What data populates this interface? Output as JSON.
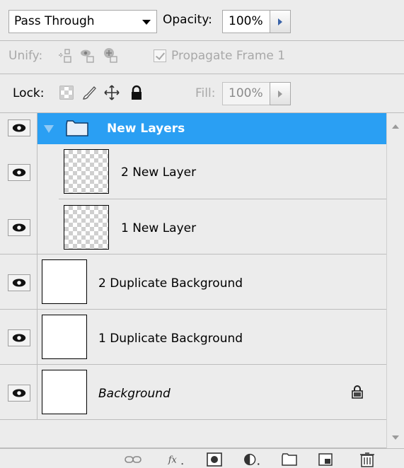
{
  "header": {
    "blend_mode": "Pass Through",
    "opacity_label": "Opacity:",
    "opacity_value": "100%",
    "unify_label": "Unify:",
    "propagate_label": "Propagate Frame 1",
    "propagate_checked": true,
    "lock_label": "Lock:",
    "fill_label": "Fill:",
    "fill_value": "100%"
  },
  "layers": [
    {
      "name": "New Layers",
      "kind": "group",
      "visible": true,
      "selected": true,
      "expanded": true
    },
    {
      "name": "2 New Layer",
      "kind": "layer",
      "visible": true,
      "transparent": true,
      "in_group": true
    },
    {
      "name": "1 New Layer",
      "kind": "layer",
      "visible": true,
      "transparent": true,
      "in_group": true
    },
    {
      "name": "2 Duplicate Background",
      "kind": "layer",
      "visible": true
    },
    {
      "name": "1 Duplicate Background",
      "kind": "layer",
      "visible": true
    },
    {
      "name": "Background",
      "kind": "background",
      "visible": true,
      "locked": true,
      "italic": true
    }
  ],
  "icons": {
    "visibility": "eye-icon",
    "group": "folder-icon",
    "lock": "lock-icon",
    "toolbar": [
      "link-layers-icon",
      "fx-icon",
      "layer-mask-icon",
      "adjustment-layer-icon",
      "new-group-icon",
      "new-layer-icon",
      "trash-icon"
    ]
  },
  "colors": {
    "selection": "#2a9ff3",
    "panel": "#ececec",
    "disabled_text": "#a8a8a8"
  }
}
